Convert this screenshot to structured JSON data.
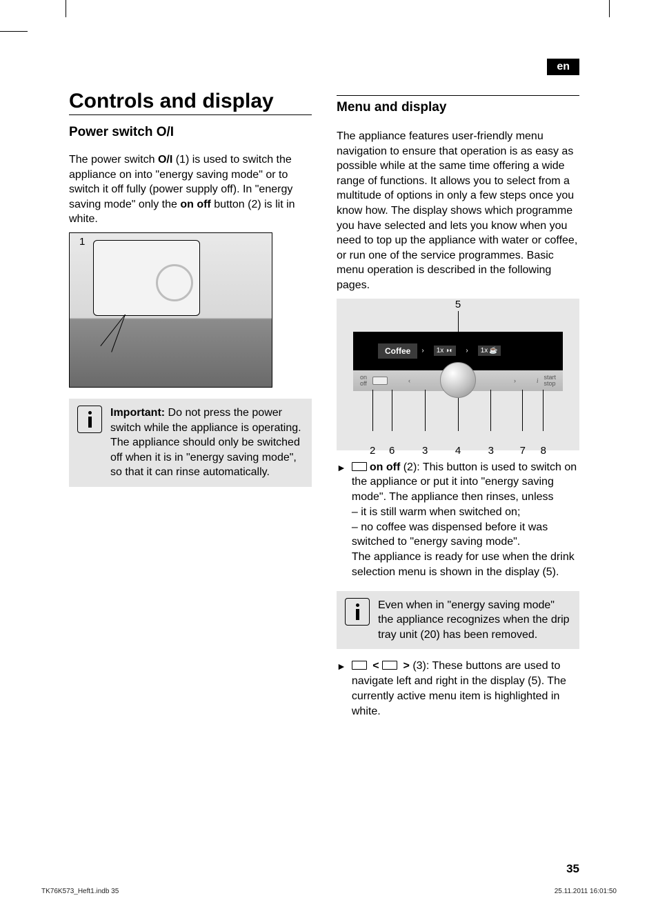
{
  "lang_tab": "en",
  "left": {
    "title": "Controls and display",
    "h2": "Power switch O/I",
    "p1a": "The power switch ",
    "p1b": "O/I",
    "p1c": " (1) is used to switch the appliance on into \"energy saving mode\" or to switch it off fully (power supply off). In \"energy saving mode\" only the ",
    "p1d": "on off",
    "p1e": " button (2) is lit in white.",
    "fig1_label": "1",
    "info_b": "Important:",
    "info_txt": " Do not press the power switch while the appliance is operating. The appliance should only be switched off when it is in \"energy saving mode\", so that it can rinse automatically."
  },
  "right": {
    "h2": "Menu and display",
    "p1": "The appliance features user-friendly menu navigation to ensure that operation is as easy as possible while at the same time offering a wide range of functions. It allows you to select from a multitude of options in only a few steps once you know how. The display shows which programme you have selected and lets you know when you need to top up the appliance with water or coffee, or run one of the service programmes. Basic menu operation is described in the following pages.",
    "fig2": {
      "top_label": "5",
      "coffee": "Coffee",
      "seg1": "1x",
      "seg2": "1x",
      "panel_on_off": "on\noff",
      "panel_start": "start\nstop",
      "labels": {
        "l2": "2",
        "l6": "6",
        "l3a": "3",
        "l4": "4",
        "l3b": "3",
        "l7": "7",
        "l8": "8"
      }
    },
    "b1_b": "on off",
    "b1_txt1": " (2): This button is used to switch on the appliance or put it into \"energy saving mode\". The appliance then rinses, unless",
    "b1_d1": "– it is still warm when switched on;",
    "b1_d2": "– no coffee was dispensed before it was switched to \"energy saving mode\".",
    "b1_txt2": "The appliance is ready for use when the drink selection menu is shown in the display (5).",
    "info2": "Even when in \"energy saving mode\" the appliance recognizes when the drip tray unit (20) has been removed.",
    "b2_mid": " < ",
    "b2_mid2": " > ",
    "b2_txt": "(3): These buttons are used to navigate left and right in the display (5). The currently active menu item is highlighted in white."
  },
  "page_num": "35",
  "footer_left": "TK76K573_Heft1.indb   35",
  "footer_right": "25.11.2011   16:01:50"
}
